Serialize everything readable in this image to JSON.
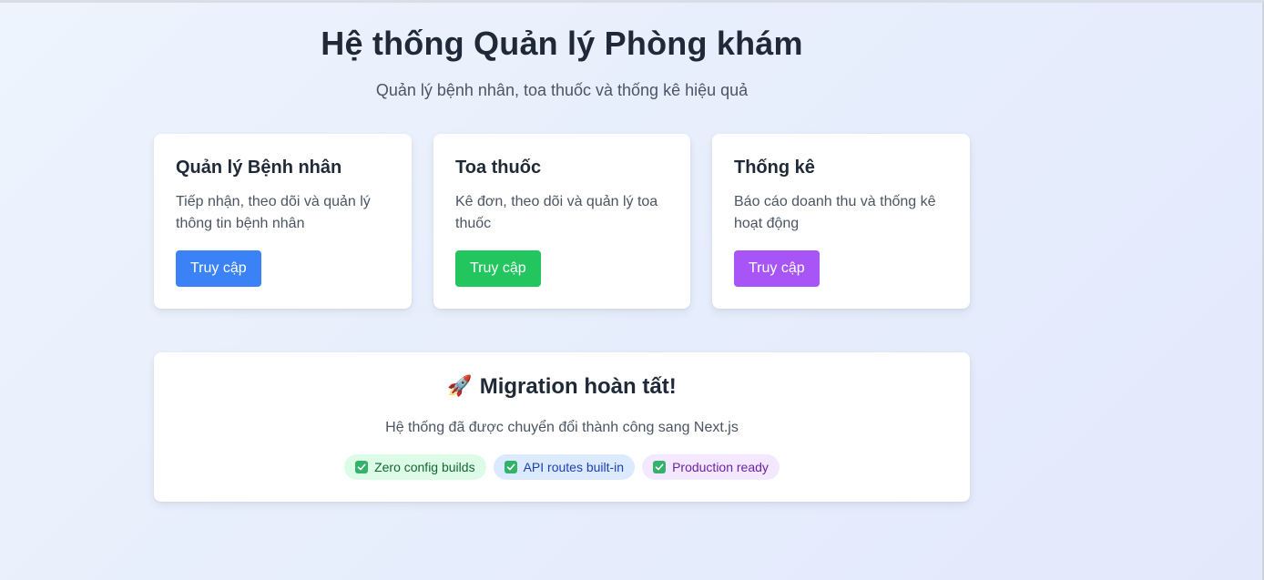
{
  "header": {
    "title": "Hệ thống Quản lý Phòng khám",
    "subtitle": "Quản lý bệnh nhân, toa thuốc và thống kê hiệu quả"
  },
  "cards": [
    {
      "title": "Quản lý Bệnh nhân",
      "description": "Tiếp nhận, theo dõi và quản lý thông tin bệnh nhân",
      "button_label": "Truy cập",
      "button_color": "#3b82f6"
    },
    {
      "title": "Toa thuốc",
      "description": "Kê đơn, theo dõi và quản lý toa thuốc",
      "button_label": "Truy cập",
      "button_color": "#22c55e"
    },
    {
      "title": "Thống kê",
      "description": "Báo cáo doanh thu và thống kê hoạt động",
      "button_label": "Truy cập",
      "button_color": "#a855f7"
    }
  ],
  "migration": {
    "icon": "rocket-icon",
    "title": "Migration hoàn tất!",
    "description": "Hệ thống đã được chuyển đổi thành công sang Next.js",
    "badges": [
      {
        "icon": "check-icon",
        "label": "Zero config builds"
      },
      {
        "icon": "check-icon",
        "label": "API routes built-in"
      },
      {
        "icon": "check-icon",
        "label": "Production ready"
      }
    ]
  }
}
